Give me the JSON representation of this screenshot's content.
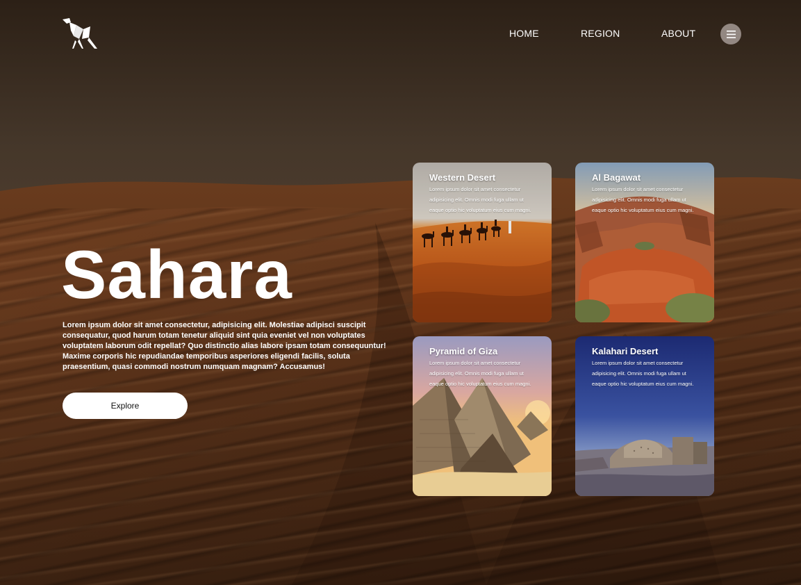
{
  "brand": {
    "logo_icon": "origami-camel-icon"
  },
  "nav": {
    "items": [
      {
        "label": "HOME"
      },
      {
        "label": "REGION"
      },
      {
        "label": "ABOUT"
      }
    ],
    "menu_icon": "hamburger-menu-icon"
  },
  "hero": {
    "title": "Sahara",
    "description": "Lorem ipsum dolor sit amet consectetur, adipisicing elit. Molestiae adipisci suscipit consequatur, quod harum totam tenetur aliquid sint quia eveniet vel non voluptates voluptatem laborum odit repellat? Quo distinctio alias labore ipsam totam consequuntur! Maxime corporis hic repudiandae temporibus asperiores eligendi facilis, soluta praesentium, quasi commodi nostrum numquam magnam? Accusamus!",
    "explore_label": "Explore"
  },
  "cards": [
    {
      "title": "Western Desert",
      "body": "Lorem ipsum dolor sit amet consectetur adipisicing elit. Omnis modi fuga ullam ut eaque optio hic voluptatum eius cum magni."
    },
    {
      "title": "Al Bagawat",
      "body": "Lorem ipsum dolor sit amet consectetur adipisicing elit. Omnis modi fuga ullam ut eaque optio hic voluptatum eius cum magni."
    },
    {
      "title": "Pyramid of Giza",
      "body": "Lorem ipsum dolor sit amet consectetur adipisicing elit. Omnis modi fuga ullam ut eaque optio hic voluptatum eius cum magni."
    },
    {
      "title": "Kalahari Desert",
      "body": "Lorem ipsum dolor sit amet consectetur adipisicing elit. Omnis modi fuga ullam ut eaque optio hic voluptatum eius cum magni."
    }
  ]
}
